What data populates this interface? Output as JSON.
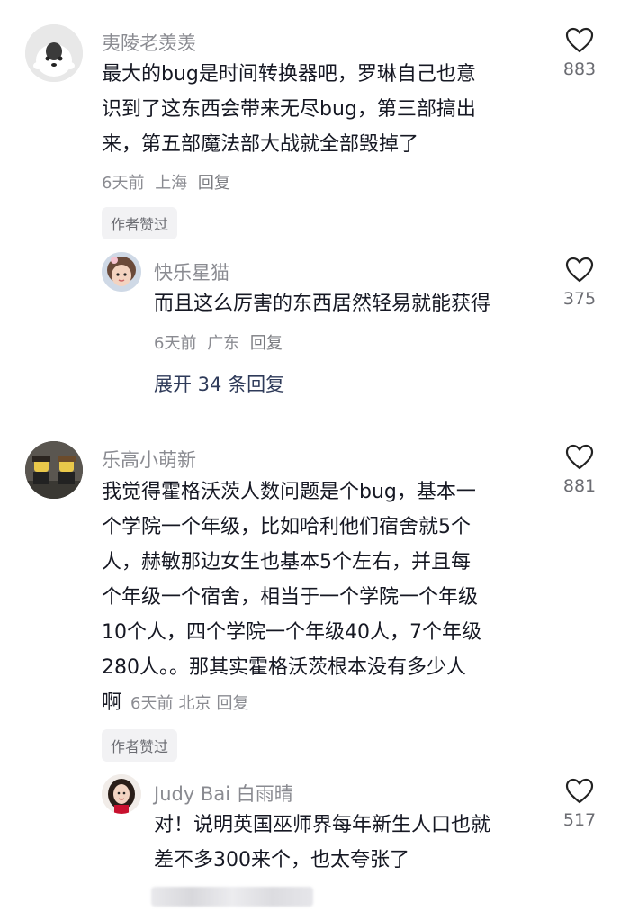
{
  "comments": [
    {
      "username": "夷陵老羡羡",
      "lines": [
        "最大的bug是时间转换器吧，罗琳自己也意",
        "识到了这东西会带来无尽bug，第三部搞出",
        "来，第五部魔法部大战就全部毁掉了"
      ],
      "time": "6天前",
      "location": "上海",
      "reply": "回复",
      "badge": "作者赞过",
      "likes": "883",
      "avatar_icon": "husky-dog-icon"
    },
    {
      "username": "快乐星猫",
      "lines": [
        "而且这么厉害的东西居然轻易就能获得"
      ],
      "time": "6天前",
      "location": "广东",
      "reply": "回复",
      "likes": "375",
      "avatar_icon": "child-avatar-icon"
    },
    {
      "expand_label": "展开 34 条回复"
    },
    {
      "username": "乐高小萌新",
      "lines": [
        "我觉得霍格沃茨人数问题是个bug，基本一",
        "个学院一个年级，比如哈利他们宿舍就5个",
        "人，赫敏那边女生也基本5个左右，并且每",
        "个年级一个宿舍，相当于一个学院一个年级",
        "10个人，四个学院一个年级40人，7个年级",
        "280人。。那其实霍格沃茨根本没有多少人"
      ],
      "last_line": "啊",
      "time": "6天前",
      "location": "北京",
      "reply": "回复",
      "badge": "作者赞过",
      "likes": "881",
      "avatar_icon": "lego-figures-icon"
    },
    {
      "username": "Judy Bai 白雨晴",
      "lines": [
        "对！说明英国巫师界每年新生人口也就",
        "差不多300来个，也太夸张了"
      ],
      "likes": "517",
      "avatar_icon": "woman-avatar-icon"
    }
  ],
  "colors": {
    "accent_text": "#161823",
    "muted": "#8a8b91",
    "badge_bg": "#f2f2f4"
  }
}
